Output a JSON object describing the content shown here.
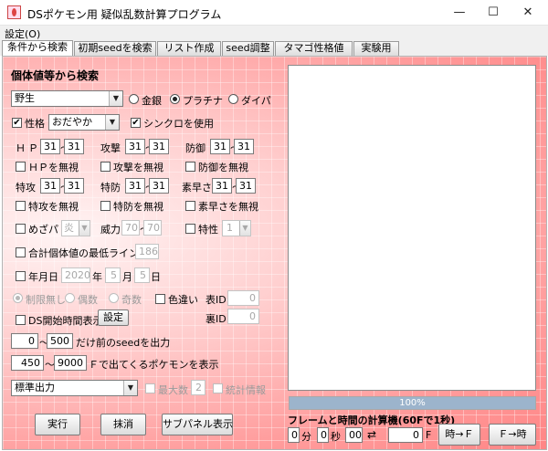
{
  "window": {
    "title": "DSポケモン用 疑似乱数計算プログラム",
    "minimize": "—",
    "maximize": "☐",
    "close": "✕"
  },
  "menu": {
    "settings": "設定(O)"
  },
  "tabs": [
    "条件から検索",
    "初期seedを検索",
    "リスト作成",
    "seed調整",
    "タマゴ性格値",
    "実験用"
  ],
  "section_title": "個体値等から検索",
  "encounter": {
    "value": "野生"
  },
  "version": {
    "options": [
      "金銀",
      "プラチナ",
      "ダイパ"
    ],
    "selected": "プラチナ"
  },
  "nature": {
    "label": "性格",
    "checked": true,
    "value": "おだやか"
  },
  "synchro": {
    "label": "シンクロを使用",
    "checked": true
  },
  "stats": {
    "tilde": "〜",
    "hp": {
      "label": "ＨＰ",
      "min": "31",
      "max": "31",
      "ignore": "ＨＰを無視"
    },
    "atk": {
      "label": "攻撃",
      "min": "31",
      "max": "31",
      "ignore": "攻撃を無視"
    },
    "def": {
      "label": "防御",
      "min": "31",
      "max": "31",
      "ignore": "防御を無視"
    },
    "spa": {
      "label": "特攻",
      "min": "31",
      "max": "31",
      "ignore": "特攻を無視"
    },
    "spd": {
      "label": "特防",
      "min": "31",
      "max": "31",
      "ignore": "特防を無視"
    },
    "spe": {
      "label": "素早さ",
      "min": "31",
      "max": "31",
      "ignore": "素早さを無視"
    }
  },
  "hidden_power": {
    "label": "めざパ",
    "type": "炎",
    "power_label": "威力",
    "power_min": "70",
    "power_max": "70"
  },
  "ability": {
    "label": "特性",
    "value": "1"
  },
  "min_total": {
    "label": "合計個体値の最低ライン",
    "value": "186"
  },
  "date": {
    "label": "年月日",
    "year": "2020",
    "year_unit": "年",
    "month": "5",
    "month_unit": "月",
    "day": "5",
    "day_unit": "日"
  },
  "parity": {
    "options": [
      "制限無し",
      "偶数",
      "奇数"
    ],
    "selected": "制限無し"
  },
  "shiny": {
    "label": "色違い",
    "tid_label": "表ID",
    "tid": "0",
    "sid_label": "裏ID",
    "sid": "0"
  },
  "ds_time": {
    "label": "DS開始時間表示",
    "button": "設定"
  },
  "seed_range": {
    "from": "0",
    "to": "500",
    "suffix": "だけ前のseedを出力"
  },
  "frame_range": {
    "from": "450",
    "to": "9000",
    "suffix": "Ｆで出てくるポケモンを表示"
  },
  "output_mode": {
    "value": "標準出力",
    "opt1_label": "最大数",
    "opt1_value": "2",
    "opt2_label": "統計情報"
  },
  "buttons": {
    "run": "実行",
    "clear": "抹消",
    "sub_panel": "サブパネル表示"
  },
  "progress": {
    "value": 1.0,
    "text": "100%"
  },
  "calc": {
    "title": "フレームと時間の計算機(60Fで1秒)",
    "min": "0",
    "min_unit": "分",
    "sec": "0",
    "sec_unit": "秒",
    "cs": "00",
    "swap": "⇄",
    "frame": "0",
    "frame_unit": "F",
    "time_to_f": "時→Ｆ",
    "f_to_time": "Ｆ→時"
  }
}
